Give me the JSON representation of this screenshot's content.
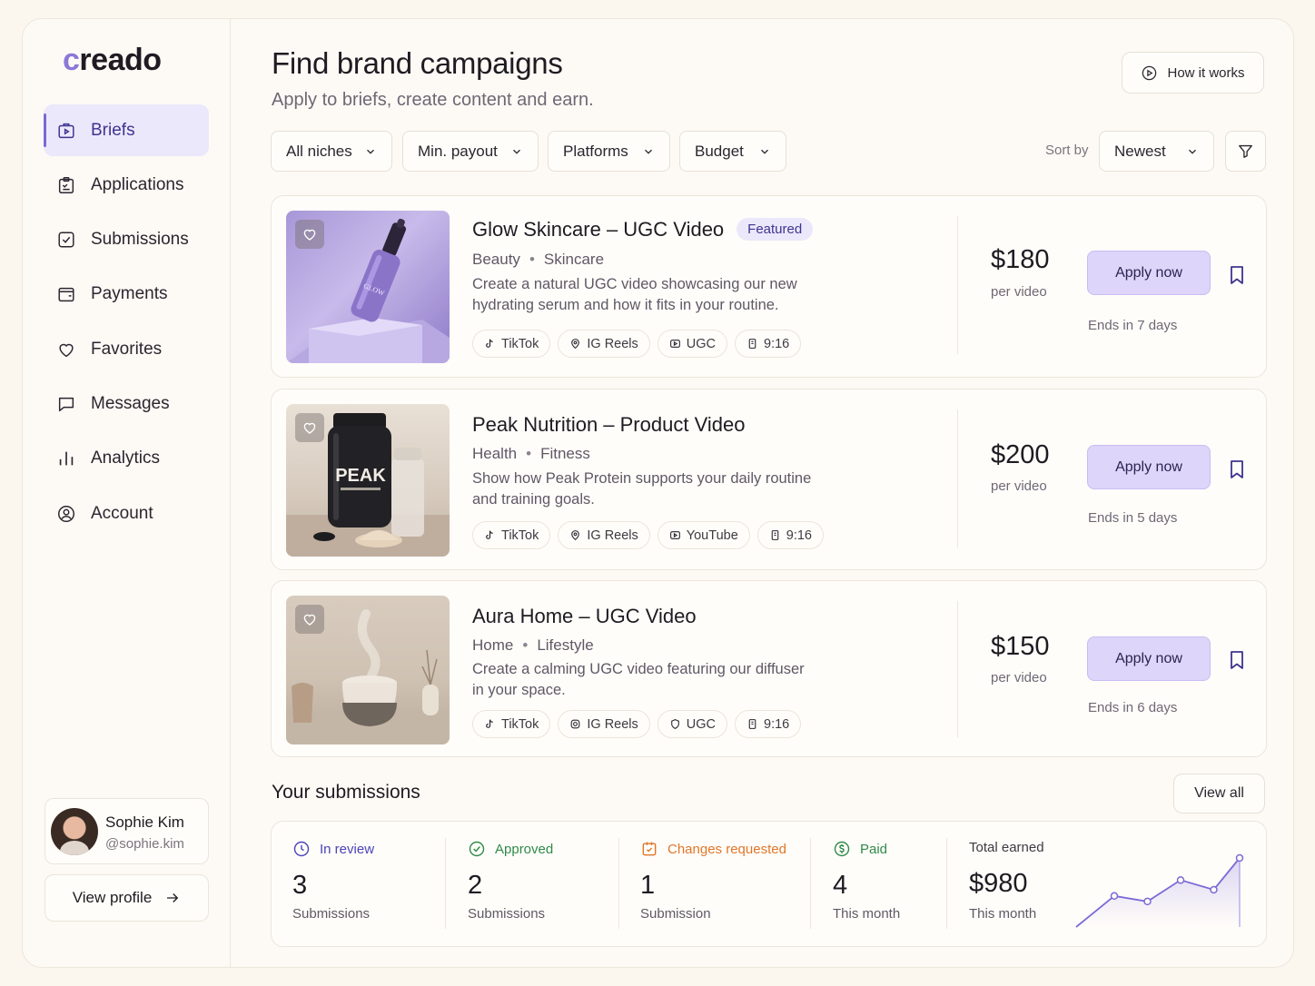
{
  "app": {
    "logo_first": "c",
    "logo_rest": "reado",
    "accent_color": "#7a6ad6"
  },
  "sidebar": {
    "items": [
      {
        "label": "Briefs",
        "icon": "briefs-icon",
        "active": true
      },
      {
        "label": "Applications",
        "icon": "clipboard-icon"
      },
      {
        "label": "Submissions",
        "icon": "check-square-icon"
      },
      {
        "label": "Payments",
        "icon": "wallet-icon"
      },
      {
        "label": "Favorites",
        "icon": "heart-icon"
      },
      {
        "label": "Messages",
        "icon": "message-icon"
      },
      {
        "label": "Analytics",
        "icon": "bar-chart-icon"
      },
      {
        "label": "Account",
        "icon": "user-circle-icon"
      }
    ],
    "user": {
      "name": "Sophie Kim",
      "handle": "@sophie.kim"
    },
    "view_profile_label": "View profile"
  },
  "header": {
    "title": "Find brand campaigns",
    "subtitle": "Apply to briefs, create content and earn.",
    "how_it_works": "How it works"
  },
  "filters": {
    "niches": "All niches",
    "payout": "Min. payout",
    "platforms": "Platforms",
    "budget": "Budget",
    "sort_label": "Sort by",
    "sort_value": "Newest"
  },
  "campaigns": [
    {
      "title": "Glow Skincare – UGC Video",
      "badge": "Featured",
      "category": "Beauty",
      "subcategory": "Skincare",
      "description": "Create a natural UGC video showcasing our new hydrating serum and how it fits in your routine.",
      "tags": [
        "TikTok",
        "IG Reels",
        "UGC",
        "9:16"
      ],
      "price": "$180",
      "per": "per video",
      "apply": "Apply now",
      "ends": "Ends in 7 days"
    },
    {
      "title": "Peak Nutrition – Product Video",
      "category": "Health",
      "subcategory": "Fitness",
      "description": "Show how Peak Protein supports your daily routine and training goals.",
      "tags": [
        "TikTok",
        "IG Reels",
        "YouTube",
        "9:16"
      ],
      "price": "$200",
      "per": "per video",
      "apply": "Apply now",
      "ends": "Ends in 5 days",
      "product_label": "PEAK"
    },
    {
      "title": "Aura Home – UGC Video",
      "category": "Home",
      "subcategory": "Lifestyle",
      "description": "Create a calming UGC video featuring our diffuser in your space.",
      "tags": [
        "TikTok",
        "IG Reels",
        "UGC",
        "9:16"
      ],
      "price": "$150",
      "per": "per video",
      "apply": "Apply now",
      "ends": "Ends in 6 days"
    }
  ],
  "submissions": {
    "title": "Your submissions",
    "view_all": "View all",
    "stats": [
      {
        "label": "In review",
        "value": "3",
        "sub": "Submissions",
        "color": "#4a44b8"
      },
      {
        "label": "Approved",
        "value": "2",
        "sub": "Submissions",
        "color": "#2f8a4a"
      },
      {
        "label": "Changes requested",
        "value": "1",
        "sub": "Submission",
        "color": "#e0772a"
      },
      {
        "label": "Paid",
        "value": "4",
        "sub": "This month",
        "color": "#2f8a4a"
      },
      {
        "label": "Total earned",
        "value": "$980",
        "sub": "This month",
        "color": "#3e3a44"
      }
    ],
    "earnings_trend": [
      0,
      0.45,
      0.37,
      0.68,
      0.54,
      1.0
    ]
  }
}
